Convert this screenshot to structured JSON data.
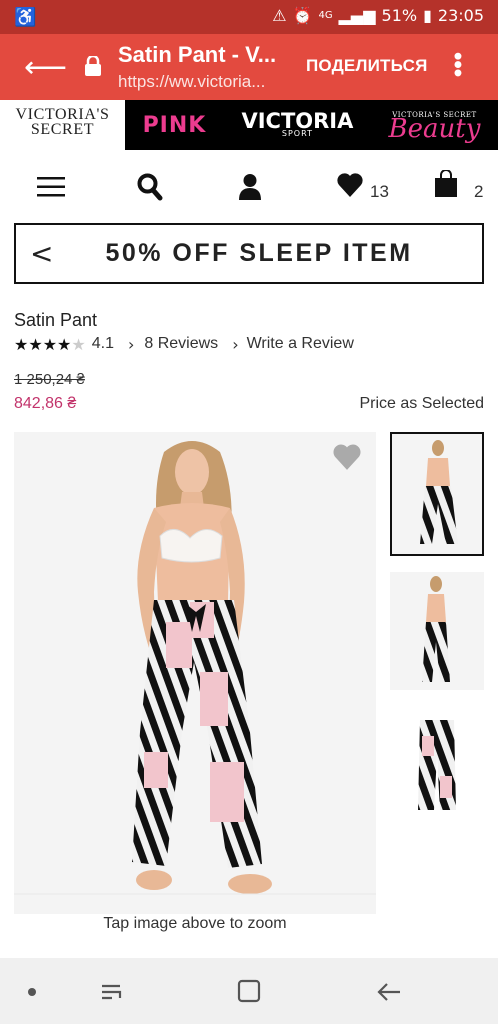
{
  "status": {
    "battery": "51%",
    "time": "23:05",
    "network": "4G"
  },
  "browser": {
    "title": "Satin Pant - V...",
    "url": "https://ww.victoria...",
    "share_label": "ПОДЕЛИТЬСЯ"
  },
  "brands": {
    "vs_line1": "VICTORIA'S",
    "vs_line2": "SECRET",
    "pink": "PINK",
    "sport_main": "VICTORIA",
    "sport_sub": "SPORT",
    "beauty_top": "VICTORIA'S SECRET",
    "beauty_main": "Beauty"
  },
  "icons": {
    "wishlist_count": "13",
    "bag_count": "2"
  },
  "promo": {
    "text": "50% OFF SLEEP ITEM"
  },
  "product": {
    "name": "Satin Pant",
    "rating": "4.1",
    "reviews_label": "8 Reviews",
    "write_review_label": "Write a Review",
    "old_price": "1 250,24 ₴",
    "new_price": "842,86 ₴",
    "price_note": "Price as Selected",
    "zoom_hint": "Tap image above to zoom"
  },
  "colors": {
    "status_bar": "#b5322a",
    "url_bar": "#e34a3f",
    "price_sale": "#c2336b",
    "pink_brand": "#ec3c8f"
  }
}
